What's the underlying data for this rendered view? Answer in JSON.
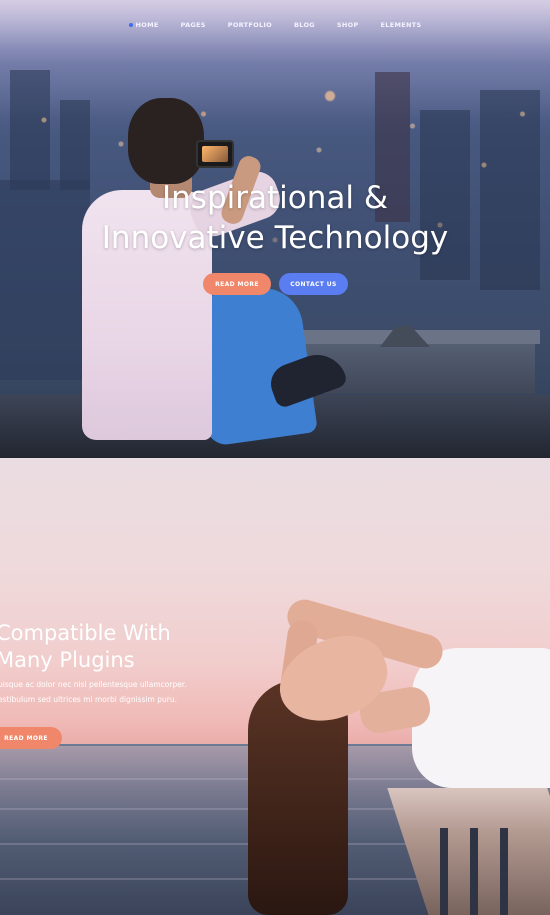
{
  "nav": {
    "items": [
      "HOME",
      "PAGES",
      "PORTFOLIO",
      "BLOG",
      "SHOP",
      "ELEMENTS"
    ],
    "active_index": 0
  },
  "hero1": {
    "title_line1": "Inspirational &",
    "title_line2": "Innovative Technology",
    "read_more": "READ MORE",
    "contact_us": "CONTACT US"
  },
  "hero2": {
    "title_line1": "Compatible With",
    "title_line2": "Many Plugins",
    "desc_line1": "uisque ac dolor nec nisl pellentesque ullamcorper.",
    "desc_line2": "estibulum sed ultrices mi morbi dignissim puru.",
    "read_more": "READ MORE"
  },
  "colors": {
    "accent_orange": "#f0876a",
    "accent_blue": "#5b7df2",
    "nav_active_dot": "#3a6df0"
  }
}
